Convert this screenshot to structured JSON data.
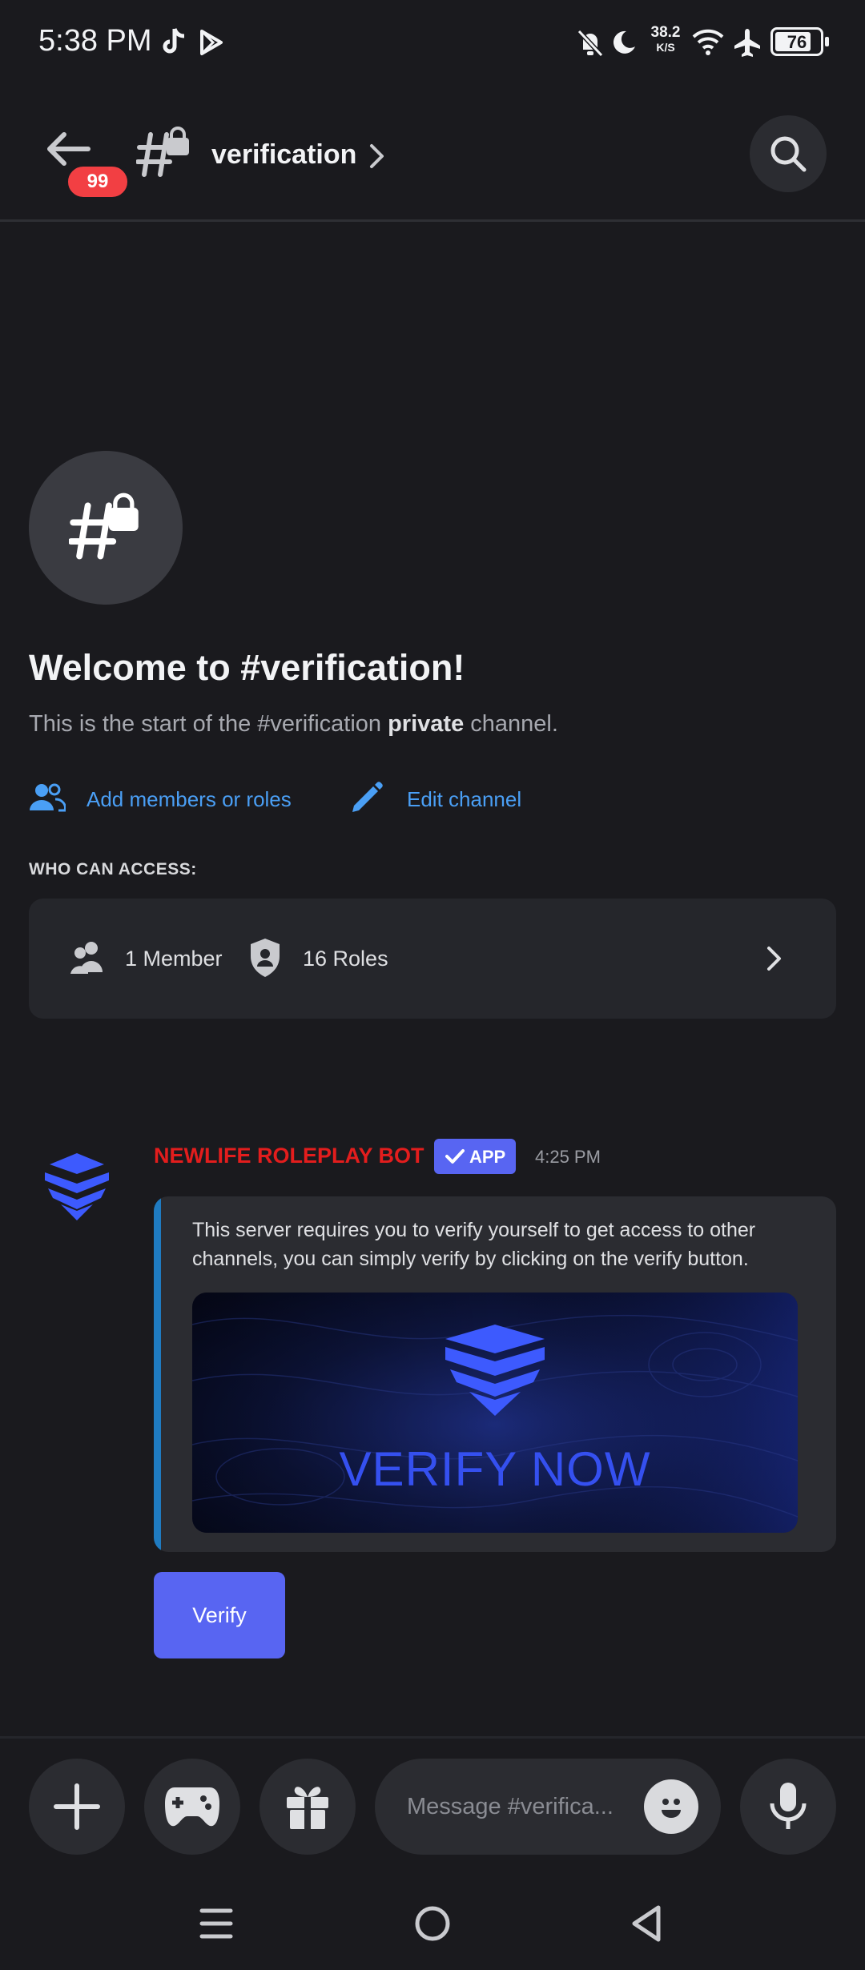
{
  "status_bar": {
    "time": "5:38 PM",
    "network_speed_value": "38.2",
    "network_speed_unit": "K/S",
    "battery": "76",
    "icons": [
      "tiktok-icon",
      "play-store-icon",
      "bell-muted-icon",
      "moon-icon",
      "wifi-icon",
      "airplane-icon",
      "battery-icon"
    ]
  },
  "header": {
    "back_badge": "99",
    "channel_name": "verification"
  },
  "welcome": {
    "title": "Welcome to #verification!",
    "subtitle_pre": "This is the start of the #verification ",
    "subtitle_bold": "private",
    "subtitle_post": " channel.",
    "add_members": "Add members or roles",
    "edit_channel": "Edit channel",
    "who_can_access": "WHO CAN ACCESS:",
    "members": "1 Member",
    "roles": "16 Roles"
  },
  "message": {
    "author": "NEWLIFE ROLEPLAY BOT",
    "app_tag": "APP",
    "time": "4:25 PM",
    "embed_text": "This server requires you to verify yourself to get access to other channels, you can simply verify by clicking on the verify button.",
    "embed_image_text": "VERIFY NOW",
    "button_label": "Verify"
  },
  "composer": {
    "placeholder": "Message #verifica..."
  },
  "colors": {
    "background": "#1a1a1e",
    "accent": "#5865f2",
    "link": "#4a9ff5",
    "bot_name": "#e31d1d",
    "badge": "#f23f43"
  }
}
